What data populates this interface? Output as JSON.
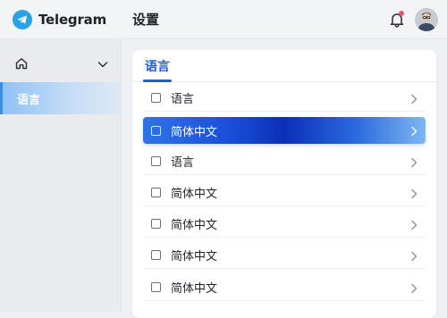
{
  "app": {
    "name": "Telegram"
  },
  "header": {
    "title": "设置"
  },
  "sidebar": {
    "items": [
      {
        "label": "语言"
      }
    ]
  },
  "card": {
    "tab": "语言",
    "rows": [
      {
        "label": "语言",
        "active": false
      },
      {
        "label": "简体中文",
        "active": true
      },
      {
        "label": "语言",
        "active": false
      },
      {
        "label": "简体中文",
        "active": false
      },
      {
        "label": "简体中文",
        "active": false
      },
      {
        "label": "简体中文",
        "active": false
      },
      {
        "label": "简体中文",
        "active": false
      }
    ]
  },
  "colors": {
    "accent": "#1f5fd6",
    "brand": "#2aa3e6",
    "notification": "#f0506e"
  }
}
